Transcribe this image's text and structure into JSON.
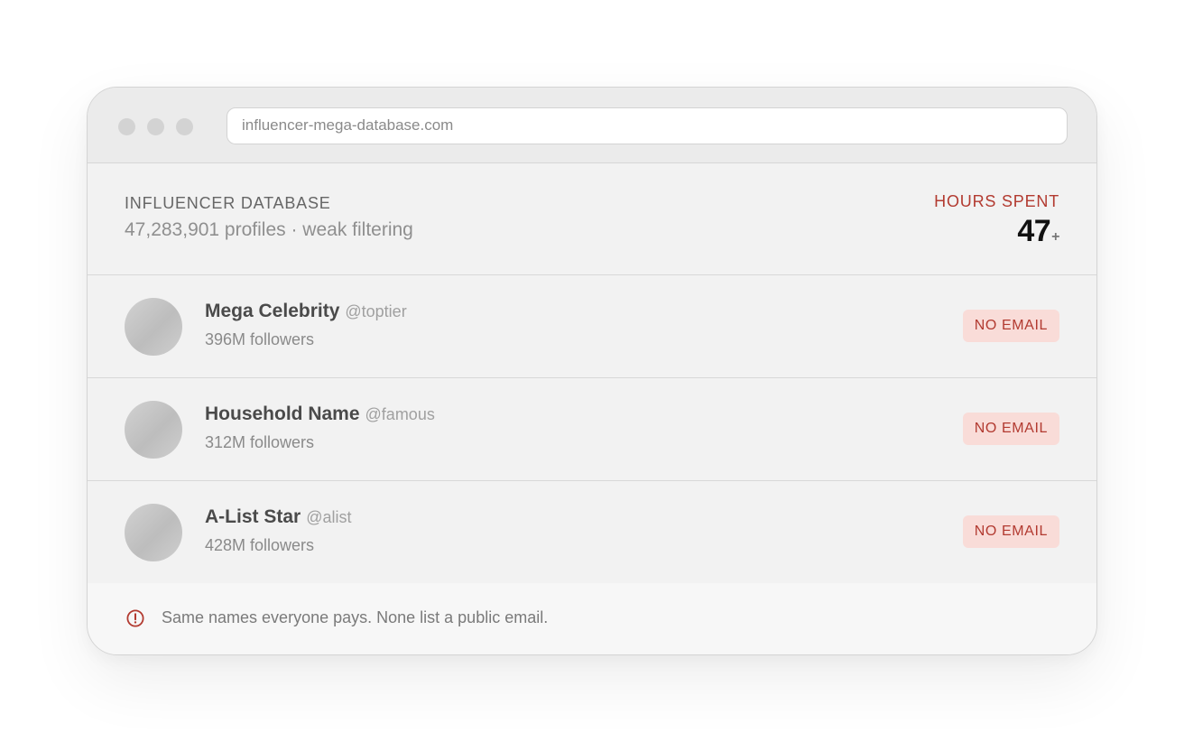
{
  "browser": {
    "url": "influencer-mega-database.com"
  },
  "header": {
    "title": "INFLUENCER DATABASE",
    "subtitle": "47,283,901 profiles · weak filtering",
    "hours_label": "HOURS SPENT",
    "hours_value": "47",
    "hours_suffix": "+"
  },
  "rows": [
    {
      "name": "Mega Celebrity",
      "handle": "@toptier",
      "followers": "396M followers",
      "badge": "NO EMAIL"
    },
    {
      "name": "Household Name",
      "handle": "@famous",
      "followers": "312M followers",
      "badge": "NO EMAIL"
    },
    {
      "name": "A-List Star",
      "handle": "@alist",
      "followers": "428M followers",
      "badge": "NO EMAIL"
    }
  ],
  "footer": {
    "message": "Same names everyone pays. None list a public email."
  },
  "colors": {
    "accent": "#b23a30",
    "badge_bg": "#f9dcd8",
    "panel_bg": "#f2f2f2"
  },
  "icons": {
    "footer_icon": "warning-icon",
    "avatar": "avatar-placeholder"
  }
}
